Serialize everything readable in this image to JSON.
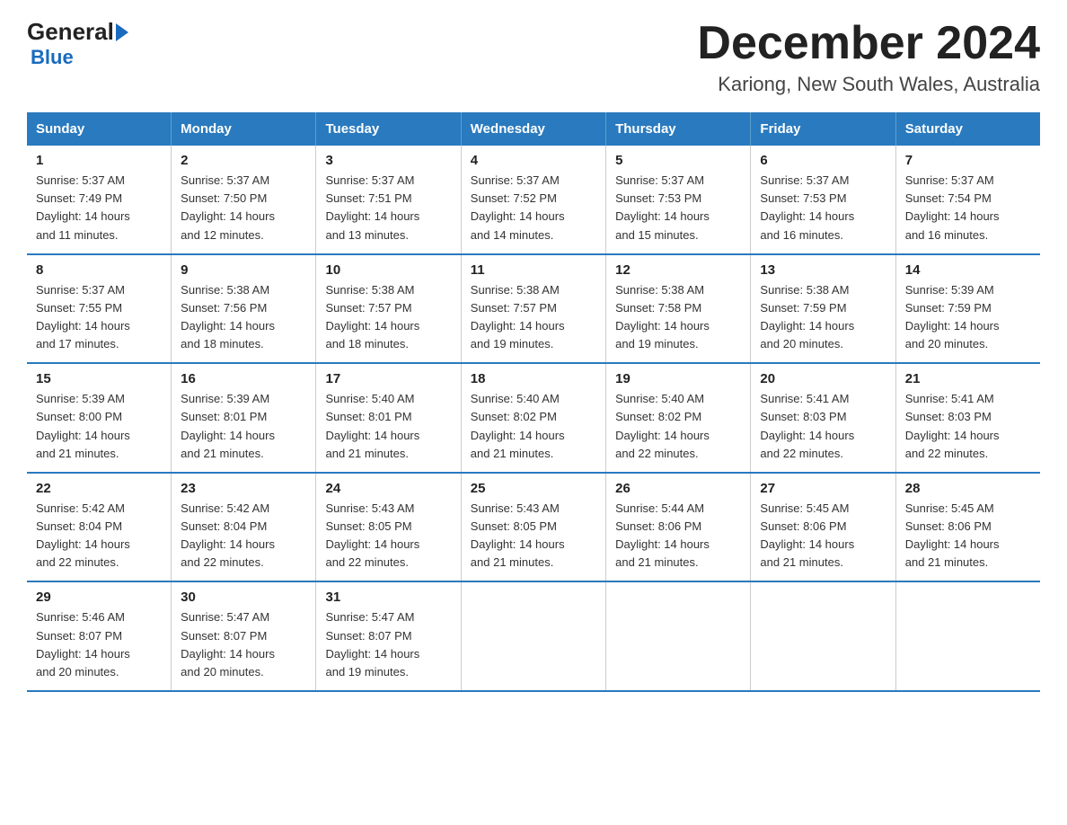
{
  "header": {
    "logo": {
      "general": "General",
      "blue": "Blue",
      "arrow": "▶"
    },
    "title": "December 2024",
    "subtitle": "Kariong, New South Wales, Australia"
  },
  "weekdays": [
    "Sunday",
    "Monday",
    "Tuesday",
    "Wednesday",
    "Thursday",
    "Friday",
    "Saturday"
  ],
  "weeks": [
    [
      {
        "day": "1",
        "sunrise": "5:37 AM",
        "sunset": "7:49 PM",
        "daylight": "14 hours and 11 minutes."
      },
      {
        "day": "2",
        "sunrise": "5:37 AM",
        "sunset": "7:50 PM",
        "daylight": "14 hours and 12 minutes."
      },
      {
        "day": "3",
        "sunrise": "5:37 AM",
        "sunset": "7:51 PM",
        "daylight": "14 hours and 13 minutes."
      },
      {
        "day": "4",
        "sunrise": "5:37 AM",
        "sunset": "7:52 PM",
        "daylight": "14 hours and 14 minutes."
      },
      {
        "day": "5",
        "sunrise": "5:37 AM",
        "sunset": "7:53 PM",
        "daylight": "14 hours and 15 minutes."
      },
      {
        "day": "6",
        "sunrise": "5:37 AM",
        "sunset": "7:53 PM",
        "daylight": "14 hours and 16 minutes."
      },
      {
        "day": "7",
        "sunrise": "5:37 AM",
        "sunset": "7:54 PM",
        "daylight": "14 hours and 16 minutes."
      }
    ],
    [
      {
        "day": "8",
        "sunrise": "5:37 AM",
        "sunset": "7:55 PM",
        "daylight": "14 hours and 17 minutes."
      },
      {
        "day": "9",
        "sunrise": "5:38 AM",
        "sunset": "7:56 PM",
        "daylight": "14 hours and 18 minutes."
      },
      {
        "day": "10",
        "sunrise": "5:38 AM",
        "sunset": "7:57 PM",
        "daylight": "14 hours and 18 minutes."
      },
      {
        "day": "11",
        "sunrise": "5:38 AM",
        "sunset": "7:57 PM",
        "daylight": "14 hours and 19 minutes."
      },
      {
        "day": "12",
        "sunrise": "5:38 AM",
        "sunset": "7:58 PM",
        "daylight": "14 hours and 19 minutes."
      },
      {
        "day": "13",
        "sunrise": "5:38 AM",
        "sunset": "7:59 PM",
        "daylight": "14 hours and 20 minutes."
      },
      {
        "day": "14",
        "sunrise": "5:39 AM",
        "sunset": "7:59 PM",
        "daylight": "14 hours and 20 minutes."
      }
    ],
    [
      {
        "day": "15",
        "sunrise": "5:39 AM",
        "sunset": "8:00 PM",
        "daylight": "14 hours and 21 minutes."
      },
      {
        "day": "16",
        "sunrise": "5:39 AM",
        "sunset": "8:01 PM",
        "daylight": "14 hours and 21 minutes."
      },
      {
        "day": "17",
        "sunrise": "5:40 AM",
        "sunset": "8:01 PM",
        "daylight": "14 hours and 21 minutes."
      },
      {
        "day": "18",
        "sunrise": "5:40 AM",
        "sunset": "8:02 PM",
        "daylight": "14 hours and 21 minutes."
      },
      {
        "day": "19",
        "sunrise": "5:40 AM",
        "sunset": "8:02 PM",
        "daylight": "14 hours and 22 minutes."
      },
      {
        "day": "20",
        "sunrise": "5:41 AM",
        "sunset": "8:03 PM",
        "daylight": "14 hours and 22 minutes."
      },
      {
        "day": "21",
        "sunrise": "5:41 AM",
        "sunset": "8:03 PM",
        "daylight": "14 hours and 22 minutes."
      }
    ],
    [
      {
        "day": "22",
        "sunrise": "5:42 AM",
        "sunset": "8:04 PM",
        "daylight": "14 hours and 22 minutes."
      },
      {
        "day": "23",
        "sunrise": "5:42 AM",
        "sunset": "8:04 PM",
        "daylight": "14 hours and 22 minutes."
      },
      {
        "day": "24",
        "sunrise": "5:43 AM",
        "sunset": "8:05 PM",
        "daylight": "14 hours and 22 minutes."
      },
      {
        "day": "25",
        "sunrise": "5:43 AM",
        "sunset": "8:05 PM",
        "daylight": "14 hours and 21 minutes."
      },
      {
        "day": "26",
        "sunrise": "5:44 AM",
        "sunset": "8:06 PM",
        "daylight": "14 hours and 21 minutes."
      },
      {
        "day": "27",
        "sunrise": "5:45 AM",
        "sunset": "8:06 PM",
        "daylight": "14 hours and 21 minutes."
      },
      {
        "day": "28",
        "sunrise": "5:45 AM",
        "sunset": "8:06 PM",
        "daylight": "14 hours and 21 minutes."
      }
    ],
    [
      {
        "day": "29",
        "sunrise": "5:46 AM",
        "sunset": "8:07 PM",
        "daylight": "14 hours and 20 minutes."
      },
      {
        "day": "30",
        "sunrise": "5:47 AM",
        "sunset": "8:07 PM",
        "daylight": "14 hours and 20 minutes."
      },
      {
        "day": "31",
        "sunrise": "5:47 AM",
        "sunset": "8:07 PM",
        "daylight": "14 hours and 19 minutes."
      },
      null,
      null,
      null,
      null
    ]
  ],
  "labels": {
    "sunrise": "Sunrise:",
    "sunset": "Sunset:",
    "daylight": "Daylight:"
  }
}
